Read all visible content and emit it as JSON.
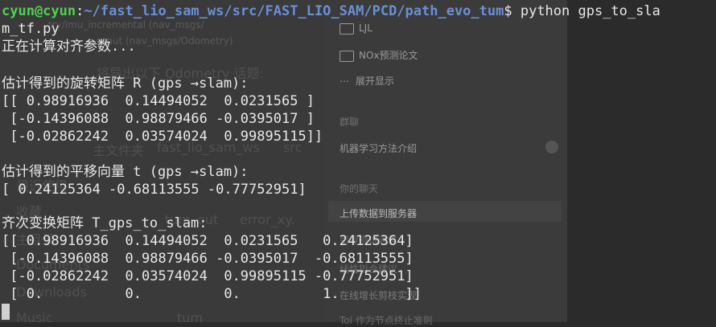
{
  "background": {
    "sidebar_items": [
      {
        "label": "LJL",
        "icon": "folder-icon"
      },
      {
        "label": "NOx预测论文",
        "icon": "folder-icon"
      },
      {
        "label": "展开显示",
        "icon": "more-icon"
      }
    ],
    "sections": [
      {
        "label": "群聊"
      },
      {
        "label": "机器学习方法介绍"
      },
      {
        "label": "你的聊天"
      },
      {
        "label": "上传数据到服务器"
      },
      {
        "label": "引导测试通信"
      },
      {
        "label": "线性拟合建议"
      },
      {
        "label": "在线增长剪枝实现"
      },
      {
        "label": "Tol 作为节点终止准则"
      }
    ],
    "left_ghost": [
      {
        "text": "try/imu_incremental (nav_msgs/"
      },
      {
        "text": "utput (nav_msgs/Odometry)"
      },
      {
        "text": "将导出以下 Odometry 话题:"
      },
      {
        "text": "主文件夹"
      },
      {
        "text": "fast_lio_sam_ws"
      },
      {
        "text": "src"
      },
      {
        "text": "最近使用"
      },
      {
        "text": "收藏"
      },
      {
        "text": "主目录"
      },
      {
        "text": "Documents"
      },
      {
        "text": "Downloads"
      },
      {
        "text": "Music"
      },
      {
        "text": "tum_out"
      },
      {
        "text": "error_xy."
      },
      {
        "text": "tum"
      }
    ]
  },
  "terminal": {
    "prompt_user": "cyun@cyun",
    "prompt_sep": ":",
    "prompt_path": "~/fast_lio_sam_ws/src/FAST_LIO_SAM/PCD/path_evo_tum",
    "prompt_symbol": "$ ",
    "command": "python gps_to_sla",
    "command_wrap": "m_tf.py",
    "lines": [
      "正在计算对齐参数...",
      "",
      "估计得到的旋转矩阵 R (gps →slam):",
      "[[ 0.98916936  0.14494052  0.0231565 ]",
      " [-0.14396088  0.98879466 -0.0395017 ]",
      " [-0.02862242  0.03574024  0.99895115]]",
      "",
      "估计得到的平移向量 t (gps →slam):",
      "[ 0.24125364 -0.68113555 -0.77752951]",
      "",
      "齐次变换矩阵 T_gps_to_slam:",
      "[[ 0.98916936  0.14494052  0.0231565   0.24125364]",
      " [-0.14396088  0.98879466 -0.0395017  -0.68113555]",
      " [-0.02862242  0.03574024  0.99895115 -0.77752951]",
      " [ 0.          0.          0.          1.        ]]"
    ]
  }
}
